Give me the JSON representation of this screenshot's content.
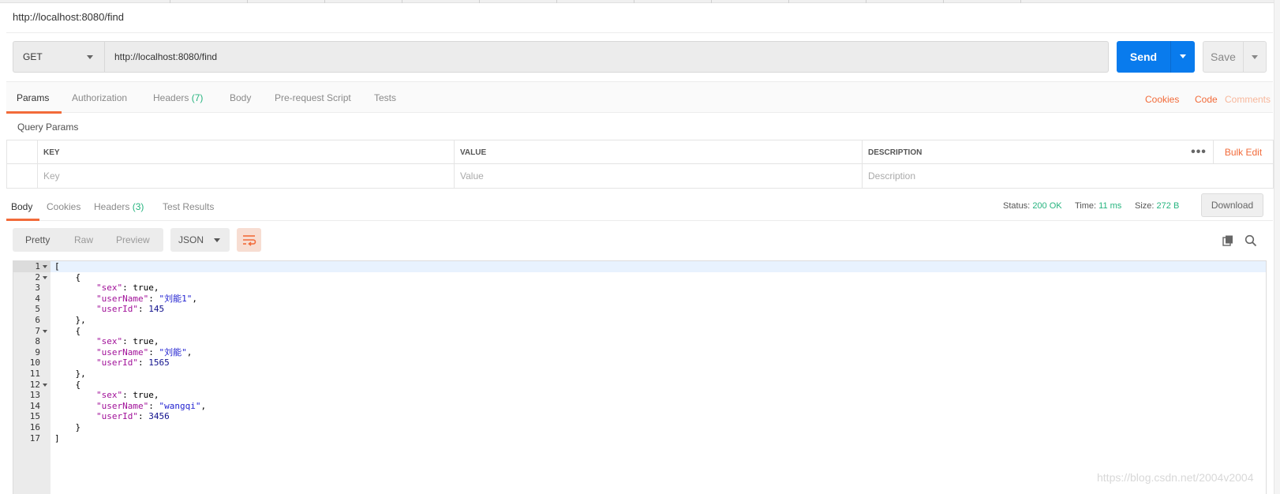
{
  "request": {
    "title": "http://localhost:8080/find",
    "method": "GET",
    "url": "http://localhost:8080/find",
    "send_label": "Send",
    "save_label": "Save"
  },
  "request_tabs": {
    "params": "Params",
    "authorization": "Authorization",
    "headers": "Headers",
    "headers_count": "(7)",
    "body": "Body",
    "pre_request": "Pre-request Script",
    "tests": "Tests",
    "cookies": "Cookies",
    "code": "Code",
    "comments": "Comments"
  },
  "query_params": {
    "title": "Query Params",
    "columns": [
      "KEY",
      "VALUE",
      "DESCRIPTION"
    ],
    "placeholders": [
      "Key",
      "Value",
      "Description"
    ],
    "more": "•••",
    "bulk_edit": "Bulk Edit"
  },
  "response_tabs": {
    "body": "Body",
    "cookies": "Cookies",
    "headers": "Headers",
    "headers_count": "(3)",
    "test_results": "Test Results"
  },
  "response_status": {
    "status_label": "Status:",
    "status_value": "200 OK",
    "time_label": "Time:",
    "time_value": "11 ms",
    "size_label": "Size:",
    "size_value": "272 B",
    "download": "Download"
  },
  "viewer": {
    "pretty": "Pretty",
    "raw": "Raw",
    "preview": "Preview",
    "format": "JSON"
  },
  "code_lines": [
    "[",
    "    {",
    "        \"sex\": true,",
    "        \"userName\": \"刘能1\",",
    "        \"userId\": 145",
    "    },",
    "    {",
    "        \"sex\": true,",
    "        \"userName\": \"刘能\",",
    "        \"userId\": 1565",
    "    },",
    "    {",
    "        \"sex\": true,",
    "        \"userName\": \"wangqi\",",
    "        \"userId\": 3456",
    "    }",
    "]"
  ],
  "fold_lines": [
    1,
    2,
    7,
    12
  ],
  "colors": {
    "accent": "#f26b3a",
    "send": "#097bed",
    "success": "#26b47f",
    "json_key": "#a11199",
    "json_string": "#1f1fd0",
    "json_number": "#10108c"
  },
  "icons": {
    "copy": "copy-icon",
    "search": "search-icon",
    "wrap": "wrap-lines-icon"
  },
  "watermark": "https://blog.csdn.net/2004v2004"
}
